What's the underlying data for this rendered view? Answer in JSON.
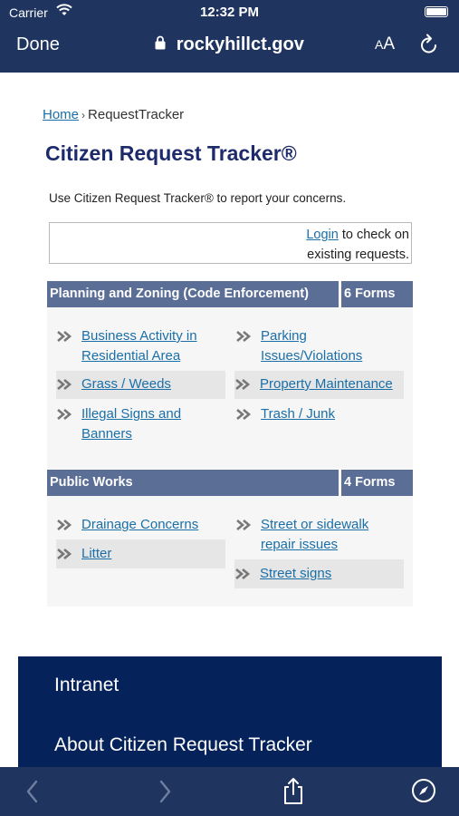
{
  "status_bar": {
    "carrier": "Carrier",
    "time": "12:32 PM"
  },
  "toolbar": {
    "done_label": "Done",
    "url": "rockyhillct.gov",
    "text_size_small": "A",
    "text_size_large": "A"
  },
  "breadcrumb": {
    "home": "Home",
    "separator": "›",
    "current": "RequestTracker"
  },
  "page": {
    "title": "Citizen Request Tracker®",
    "intro": "Use Citizen Request Tracker® to report your concerns.",
    "login_link": "Login",
    "login_text_1": "to check on",
    "login_text_2": "existing requests."
  },
  "categories": [
    {
      "name": "Planning and Zoning (Code Enforcement)",
      "count": "6 Forms",
      "forms": [
        {
          "line1": "Business Activity in",
          "line2": "Residential Area"
        },
        {
          "line1": "Parking",
          "line2": "Issues/Violations"
        },
        {
          "line1": "Grass / Weeds",
          "line2": ""
        },
        {
          "line1": "Property Maintenance",
          "line2": ""
        },
        {
          "line1": "Illegal Signs and",
          "line2": "Banners"
        },
        {
          "line1": "Trash / Junk",
          "line2": ""
        }
      ]
    },
    {
      "name": "Public Works",
      "count": "4 Forms",
      "forms": [
        {
          "line1": "Drainage Concerns",
          "line2": ""
        },
        {
          "line1": "Street or sidewalk",
          "line2": "repair issues"
        },
        {
          "line1": "Litter",
          "line2": ""
        },
        {
          "line1": "Street signs",
          "line2": ""
        }
      ]
    }
  ],
  "footer": {
    "links": [
      "Intranet",
      "About Citizen Request Tracker"
    ]
  },
  "colors": {
    "bar": "#1f3560",
    "category_header": "#5a6e96",
    "link": "#1a6fa8",
    "title": "#1d2a6b",
    "footer": "#06225b"
  },
  "icons": {
    "wifi": "wifi-icon",
    "lock": "lock-icon",
    "reload": "reload-icon",
    "back": "back-chevron-icon",
    "forward": "forward-chevron-icon",
    "share": "share-icon",
    "compass": "compass-icon",
    "form": "double-chevron-icon"
  }
}
